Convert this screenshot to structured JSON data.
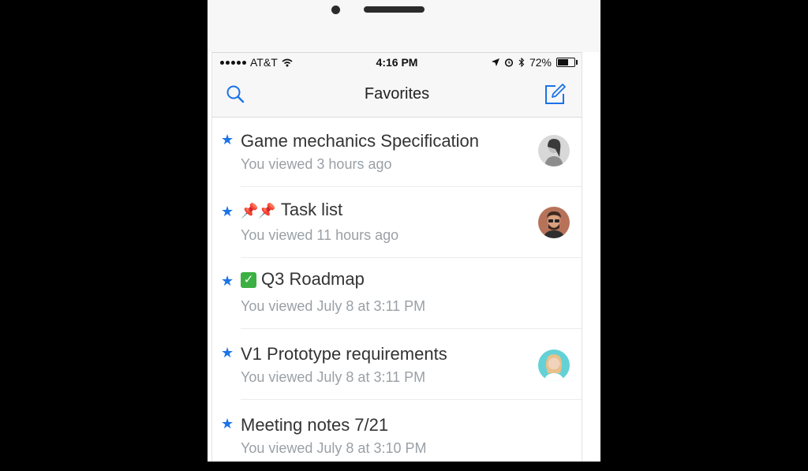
{
  "status_bar": {
    "carrier": "AT&T",
    "time": "4:16 PM",
    "battery_percent": "72%",
    "battery_level": 0.72
  },
  "nav": {
    "title": "Favorites",
    "search_icon": "search-icon",
    "compose_icon": "compose-icon"
  },
  "favorites": [
    {
      "title": "Game mechanics Specification",
      "subtitle": "You viewed 3 hours ago",
      "prefix": "",
      "avatar": "avatar-woman-grayscale"
    },
    {
      "title": "Task list",
      "subtitle": "You viewed 11 hours ago",
      "prefix": "pushpin-emoji",
      "avatar": "avatar-man-beard"
    },
    {
      "title": "Q3 Roadmap",
      "subtitle": "You viewed July 8 at 3:11 PM",
      "prefix": "check-mark-emoji",
      "avatar": ""
    },
    {
      "title": "V1 Prototype requirements",
      "subtitle": "You viewed July 8 at 3:11 PM",
      "prefix": "",
      "avatar": "avatar-woman-teal"
    },
    {
      "title": "Meeting notes 7/21",
      "subtitle": "You viewed July 8 at 3:10 PM",
      "prefix": "",
      "avatar": ""
    }
  ],
  "colors": {
    "accent": "#1a73e8",
    "subtitle": "#9aa0a6",
    "background": "#000000"
  }
}
